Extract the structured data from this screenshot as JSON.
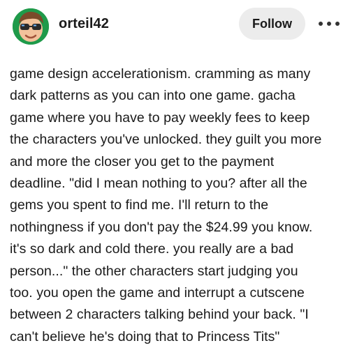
{
  "post": {
    "author": {
      "username": "orteil42",
      "avatar_icon": "cartoon-face-with-sunglasses-avatar-icon"
    },
    "actions": {
      "follow_label": "Follow",
      "more_icon": "more-options-ellipsis-icon"
    },
    "text": "game design accelerationism. cramming as many\ndark patterns as you can into one game. gacha\ngame where you have to pay weekly fees to keep\nthe characters you've unlocked. they guilt you more\nand more the closer you get to the payment\ndeadline. \"did I mean nothing to you? after all the\ngems you spent to find me. I'll return to the\nnothingness if you don't pay the $24.99 you know.\nit's so dark and cold there. you really are a bad\nperson...\" the other characters start judging you\ntoo. you open the game and interrupt a cutscene\nbetween 2 characters talking behind your back. \"I\ncan't believe he's doing that to Princess Tits\""
  },
  "colors": {
    "text": "#1a1a1a",
    "button_bg": "#ececec",
    "avatar_bg": "#1f9a4a",
    "background": "#ffffff"
  }
}
